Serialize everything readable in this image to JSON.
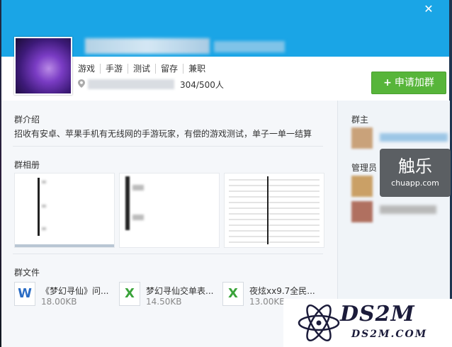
{
  "header": {
    "close_icon": "close-icon"
  },
  "tags": [
    "游戏",
    "手游",
    "测试",
    "留存",
    "兼职"
  ],
  "location": {
    "icon": "location-pin-icon",
    "members": "304/500人"
  },
  "join_button": {
    "plus": "+",
    "label": "申请加群"
  },
  "intro": {
    "title": "群介绍",
    "text": "招收有安卓、苹果手机有无线网的手游玩家，有偿的游戏测试，单子一单一结算"
  },
  "album": {
    "title": "群相册"
  },
  "files": {
    "title": "群文件",
    "items": [
      {
        "icon": "word-file-icon",
        "glyph": "W",
        "name": "《梦幻寻仙》问...",
        "size": "18.00KB"
      },
      {
        "icon": "excel-file-icon",
        "glyph": "X",
        "name": "梦幻寻仙交单表...",
        "size": "14.50KB"
      },
      {
        "icon": "excel-file-icon",
        "glyph": "X",
        "name": "夜炫xx9.7全民...",
        "size": "13.00KB"
      }
    ]
  },
  "sidebar": {
    "owner_title": "群主",
    "admin_title": "管理员"
  },
  "watermarks": {
    "chuapp_big": "触乐",
    "chuapp_small": "chuapp.com",
    "ds2m_main": "DS2M",
    "ds2m_sub": "DS2M.COM"
  },
  "colors": {
    "header": "#1aa5e6",
    "join_button": "#57b53a"
  }
}
